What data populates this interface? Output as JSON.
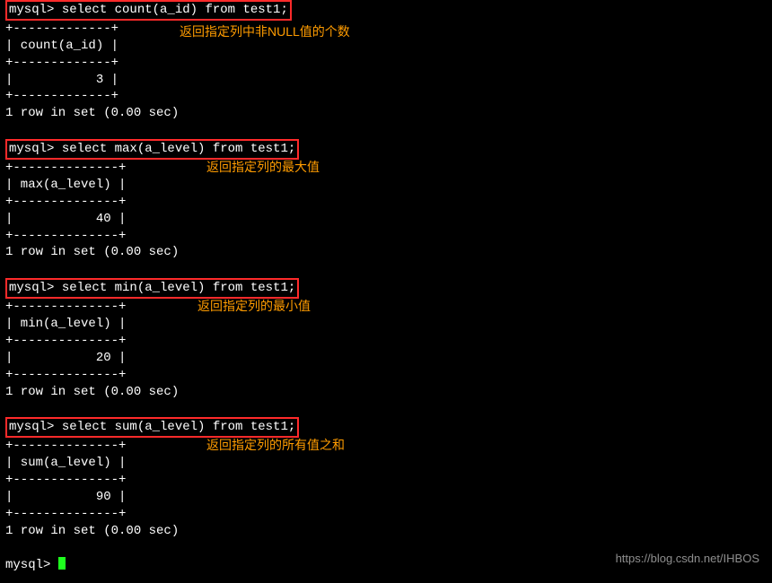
{
  "prompt": "mysql> ",
  "queries": [
    {
      "sql": "select count(a_id) from test1;",
      "col": "count(a_id)",
      "value": "3",
      "divider": "+-------------+",
      "header": "| count(a_id) |",
      "valueRow": "|           3 |",
      "status": "1 row in set (0.00 sec)",
      "annotation": "返回指定列中非NULL值的个数",
      "annTop": 26,
      "annLeft": 200
    },
    {
      "sql": "select max(a_level) from test1;",
      "col": "max(a_level)",
      "value": "40",
      "divider": "+--------------+",
      "header": "| max(a_level) |",
      "valueRow": "|           40 |",
      "status": "1 row in set (0.00 sec)",
      "annotation": "返回指定列的最大值",
      "annTop": 22,
      "annLeft": 230
    },
    {
      "sql": "select min(a_level) from test1;",
      "col": "min(a_level)",
      "value": "20",
      "divider": "+--------------+",
      "header": "| min(a_level) |",
      "valueRow": "|           20 |",
      "status": "1 row in set (0.00 sec)",
      "annotation": "返回指定列的最小值",
      "annTop": 22,
      "annLeft": 220
    },
    {
      "sql": "select sum(a_level) from test1;",
      "col": "sum(a_level)",
      "value": "90",
      "divider": "+--------------+",
      "header": "| sum(a_level) |",
      "valueRow": "|           90 |",
      "status": "1 row in set (0.00 sec)",
      "annotation": "返回指定列的所有值之和",
      "annTop": 22,
      "annLeft": 230
    }
  ],
  "finalPrompt": "mysql> ",
  "watermark": "https://blog.csdn.net/IHBOS"
}
